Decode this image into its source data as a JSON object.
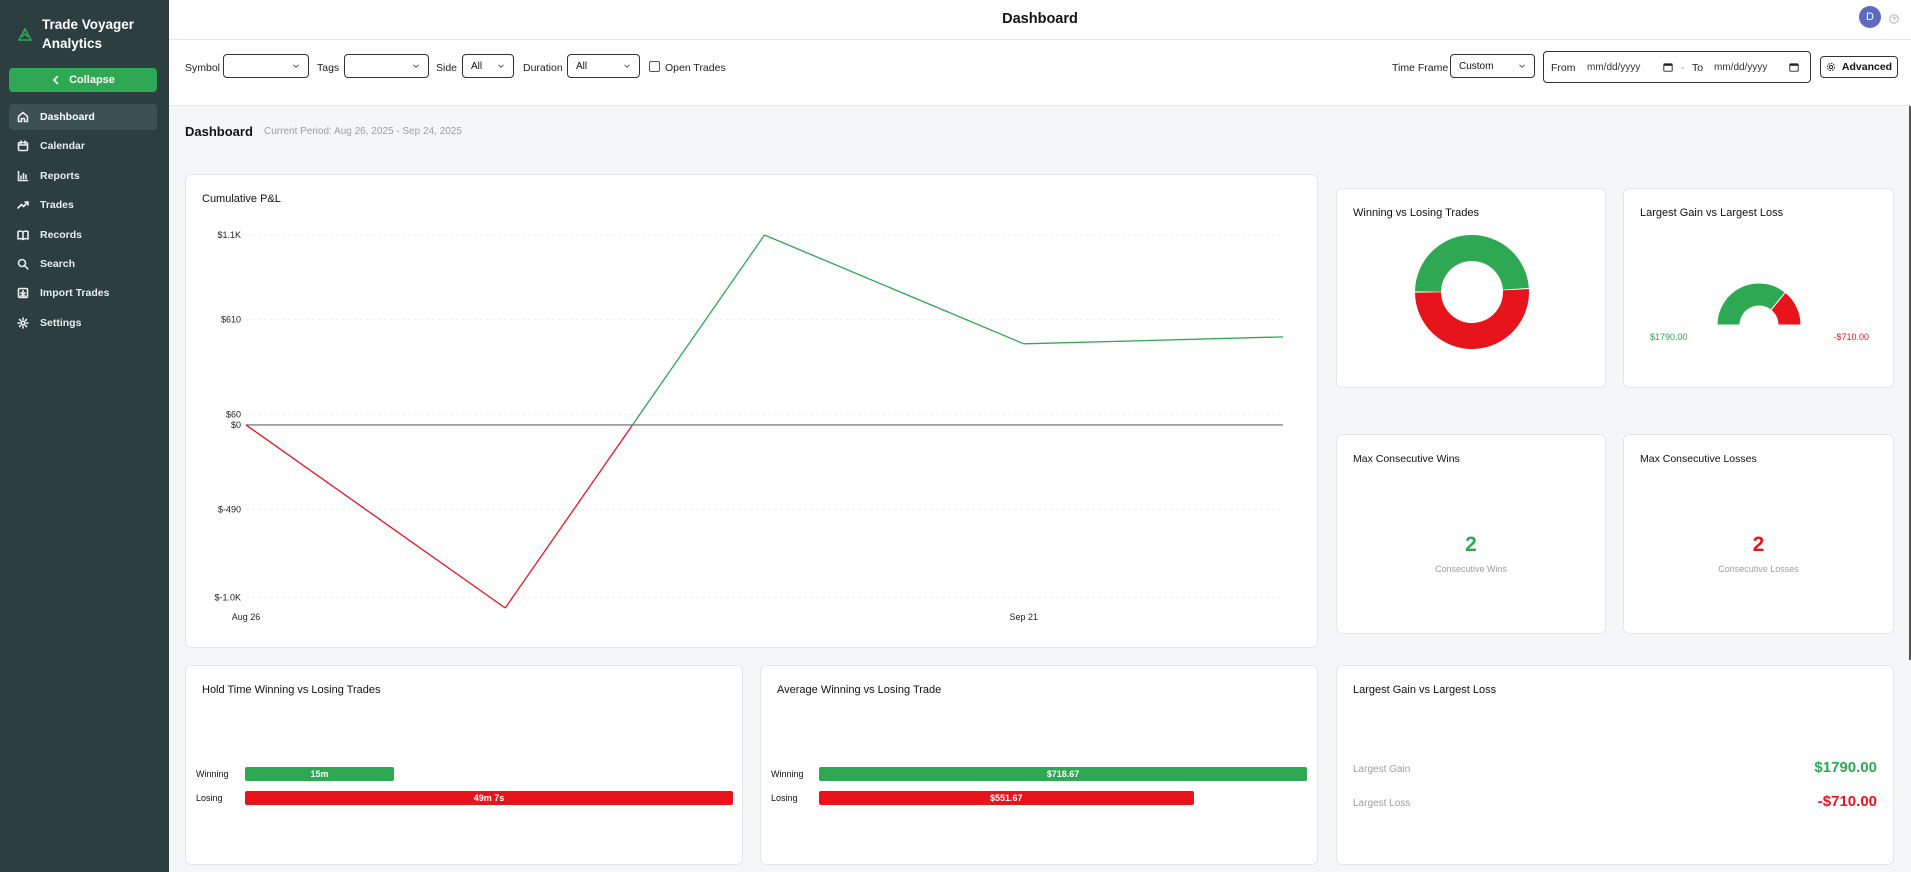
{
  "app": {
    "name_line1": "Trade Voyager",
    "name_line2": "Analytics"
  },
  "sidebar": {
    "collapse_label": "Collapse",
    "items": [
      {
        "label": "Dashboard",
        "icon": "home-icon",
        "active": true
      },
      {
        "label": "Calendar",
        "icon": "calendar-icon"
      },
      {
        "label": "Reports",
        "icon": "bar-chart-icon"
      },
      {
        "label": "Trades",
        "icon": "trending-up-icon"
      },
      {
        "label": "Records",
        "icon": "book-icon"
      },
      {
        "label": "Search",
        "icon": "search-icon"
      },
      {
        "label": "Import Trades",
        "icon": "import-icon"
      },
      {
        "label": "Settings",
        "icon": "gear-icon"
      }
    ]
  },
  "header": {
    "title": "Dashboard",
    "avatar_initial": "D"
  },
  "filters": {
    "symbol_label": "Symbol",
    "symbol_value": "",
    "tags_label": "Tags",
    "tags_value": "",
    "side_label": "Side",
    "side_value": "All",
    "duration_label": "Duration",
    "duration_value": "All",
    "open_trades_label": "Open Trades",
    "timeframe_label": "Time Frame",
    "timeframe_value": "Custom",
    "from_label": "From",
    "from_value": "mm/dd/yyyy",
    "separator": "-",
    "to_label": "To",
    "to_value": "mm/dd/yyyy",
    "advanced_label": "Advanced"
  },
  "page": {
    "heading": "Dashboard",
    "period": "Current Period: Aug 26, 2025 - Sep 24, 2025"
  },
  "colors": {
    "green": "#2ea852",
    "red": "#e8141c",
    "sidebar": "#2c3e3f"
  },
  "cards": {
    "cumulative_pnl": {
      "title": "Cumulative P&L"
    },
    "win_loss_trades": {
      "title": "Winning vs Losing Trades"
    },
    "gain_loss_gauge": {
      "title": "Largest Gain vs Largest Loss",
      "gain_label": "$1790.00",
      "loss_label": "-$710.00"
    },
    "max_wins": {
      "title": "Max Consecutive Wins",
      "value": "2",
      "sub": "Consecutive Wins"
    },
    "max_losses": {
      "title": "Max Consecutive Losses",
      "value": "2",
      "sub": "Consecutive Losses"
    },
    "hold_time": {
      "title": "Hold Time Winning vs Losing Trades",
      "win_label": "Winning",
      "win_value": "15m",
      "loss_label": "Losing",
      "loss_value": "49m 7s"
    },
    "avg_trade": {
      "title": "Average Winning vs Losing Trade",
      "win_label": "Winning",
      "win_value": "$718.67",
      "loss_label": "Losing",
      "loss_value": "$551.67"
    },
    "largest_gain_loss": {
      "title": "Largest Gain vs Largest Loss",
      "gain_label": "Largest Gain",
      "gain_value": "$1790.00",
      "loss_label": "Largest Loss",
      "loss_value": "-$710.00"
    }
  },
  "chart_data": [
    {
      "type": "line",
      "title": "Cumulative P&L",
      "x": [
        "Aug 26",
        "Sep 1",
        "Sep 10",
        "Sep 21",
        "Sep 24"
      ],
      "x_tick_labels": [
        "Aug 26",
        "Sep 21"
      ],
      "y_tick_labels": [
        "$1.1K",
        "$610",
        "$60",
        "$0",
        "$-490",
        "$-1.0K"
      ],
      "values": [
        0,
        -1060,
        1100,
        470,
        510
      ],
      "ylim": [
        -1060,
        1100
      ],
      "positive_color": "#2ea852",
      "negative_color": "#e8141c",
      "zero_line": true,
      "grid": true
    },
    {
      "type": "pie",
      "title": "Winning vs Losing Trades",
      "donut": true,
      "labels": [
        "Winning",
        "Losing"
      ],
      "values": [
        49,
        51
      ],
      "colors": [
        "#2ea852",
        "#e8141c"
      ]
    },
    {
      "type": "pie",
      "title": "Largest Gain vs Largest Loss",
      "gauge": true,
      "labels": [
        "$1790.00",
        "-$710.00"
      ],
      "values": [
        1790,
        710
      ],
      "colors": [
        "#2ea852",
        "#e8141c"
      ]
    },
    {
      "type": "bar",
      "title": "Hold Time Winning vs Losing Trades",
      "orientation": "horizontal",
      "categories": [
        "Winning",
        "Losing"
      ],
      "values": [
        15,
        49.12
      ],
      "value_labels": [
        "15m",
        "49m 7s"
      ],
      "colors": [
        "#2ea852",
        "#e8141c"
      ]
    },
    {
      "type": "bar",
      "title": "Average Winning vs Losing Trade",
      "orientation": "horizontal",
      "categories": [
        "Winning",
        "Losing"
      ],
      "values": [
        718.67,
        551.67
      ],
      "value_labels": [
        "$718.67",
        "$551.67"
      ],
      "colors": [
        "#2ea852",
        "#e8141c"
      ]
    }
  ]
}
